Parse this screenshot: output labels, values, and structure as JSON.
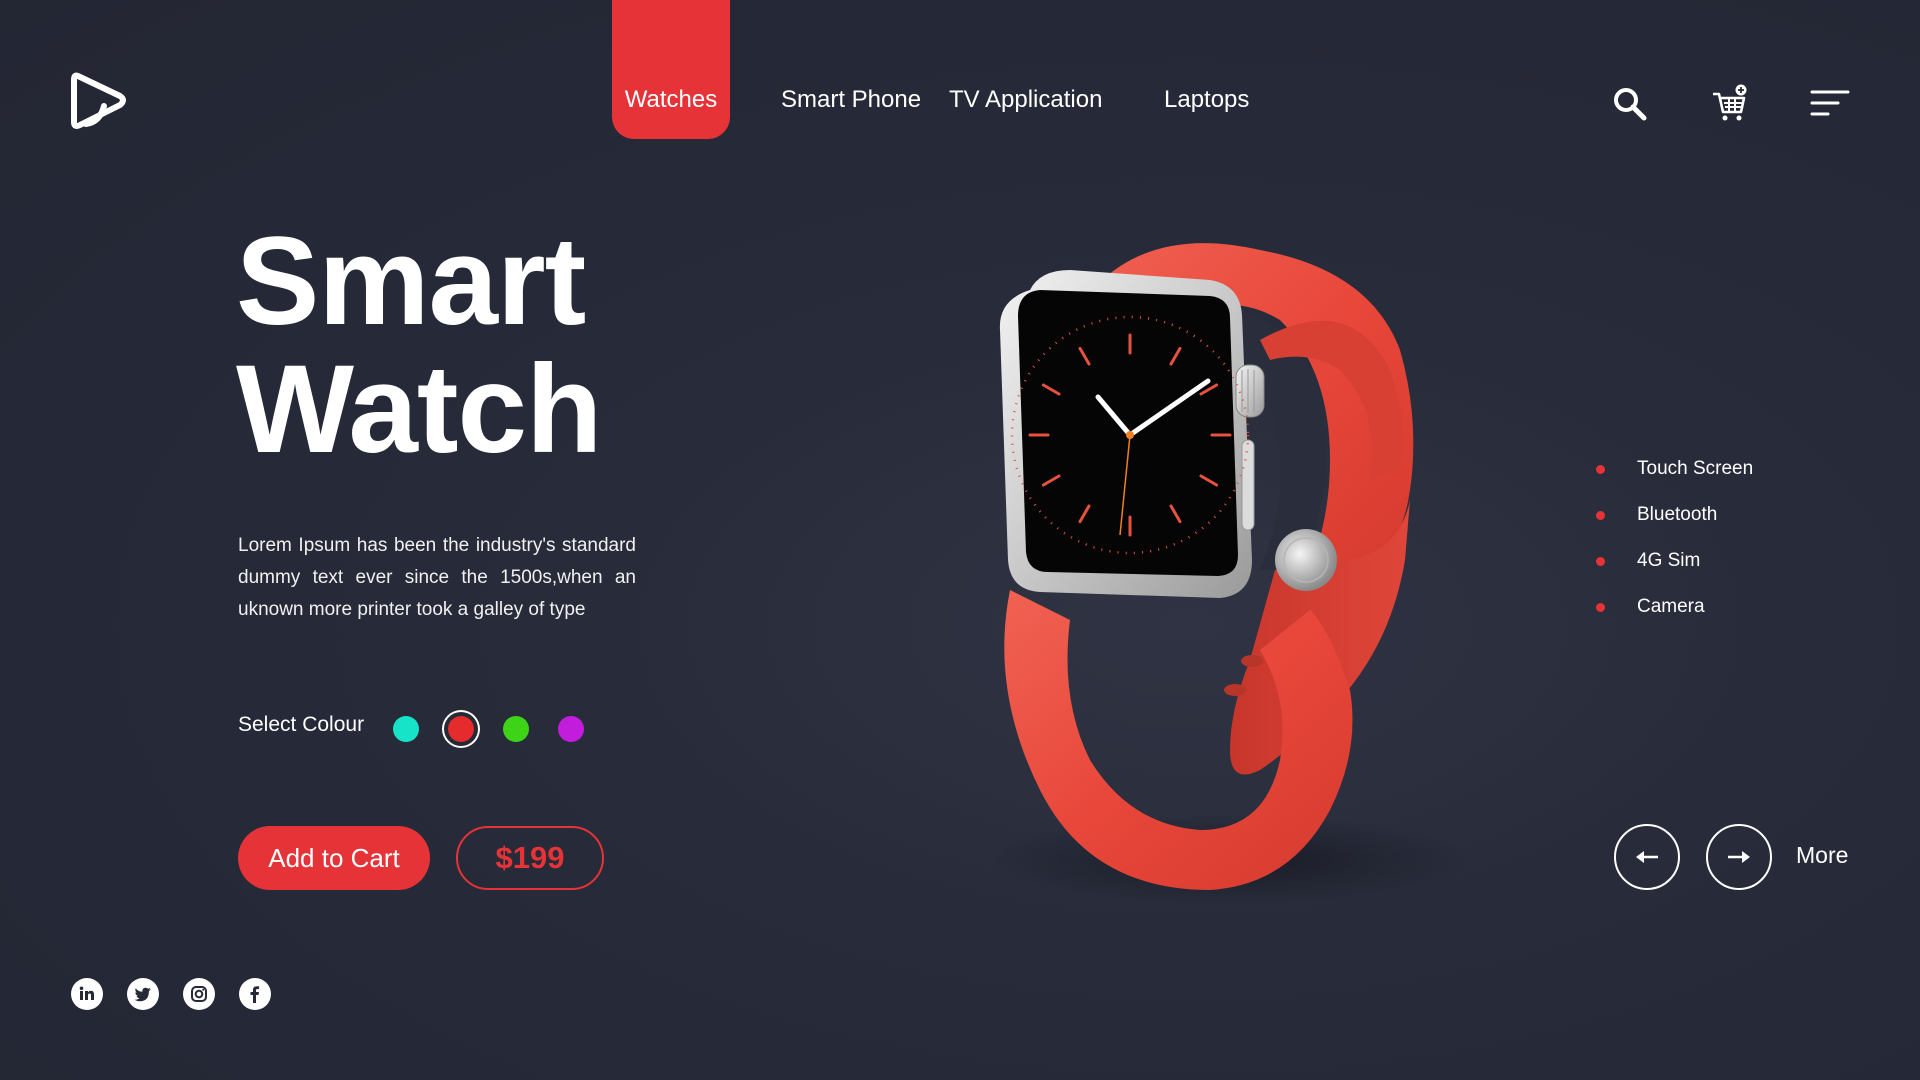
{
  "nav": {
    "items": [
      {
        "label": "Watches",
        "active": true
      },
      {
        "label": "Smart Phone",
        "active": false
      },
      {
        "label": "TV Application",
        "active": false
      },
      {
        "label": "Laptops",
        "active": false
      }
    ]
  },
  "header_icons": [
    "search-icon",
    "cart-add-icon",
    "menu-icon"
  ],
  "hero": {
    "title_line1": "Smart",
    "title_line2": "Watch",
    "description": "Lorem Ipsum has been the industry's standard dummy text ever since the 1500s,when an uknown more printer took a galley of type"
  },
  "colour_select": {
    "label": "Select Colour",
    "options": [
      {
        "color": "#16e3c8",
        "selected": false
      },
      {
        "color": "#e52b2b",
        "selected": true
      },
      {
        "color": "#3dd417",
        "selected": false
      },
      {
        "color": "#c21ddd",
        "selected": false
      }
    ]
  },
  "actions": {
    "add_to_cart": "Add to Cart",
    "price": "$199"
  },
  "features": [
    "Touch Screen",
    "Bluetooth",
    "4G Sim",
    "Camera"
  ],
  "carousel": {
    "more_label": "More"
  },
  "social": [
    "linkedin-icon",
    "twitter-icon",
    "instagram-icon",
    "facebook-icon"
  ],
  "colors": {
    "accent": "#e63337",
    "background": "#262a37",
    "text": "#ffffff"
  }
}
